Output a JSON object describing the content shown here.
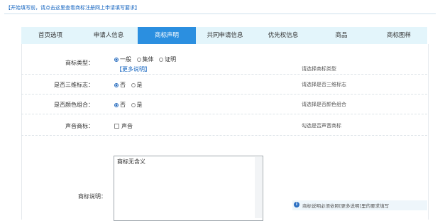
{
  "notice": "【开始填写前，请点击这里查看商标注册网上申请填写要求】",
  "tabs": [
    {
      "label": "首页选项",
      "active": false
    },
    {
      "label": "申请人信息",
      "active": false
    },
    {
      "label": "商标声明",
      "active": true
    },
    {
      "label": "共同申请信息",
      "active": false
    },
    {
      "label": "优先权信息",
      "active": false
    },
    {
      "label": "商品",
      "active": false
    },
    {
      "label": "商标图样",
      "active": false
    }
  ],
  "form": {
    "type": {
      "label": "商标类型：",
      "options": [
        "一般",
        "集体",
        "证明"
      ],
      "selected": "一般",
      "more_link": "【更多说明】",
      "hint": "请选择商标类型"
    },
    "three_d": {
      "label": "是否三维标志：",
      "options": [
        "否",
        "是"
      ],
      "selected": "否",
      "hint": "请选择是否三维标志"
    },
    "color": {
      "label": "是否颜色组合：",
      "options": [
        "否",
        "是"
      ],
      "selected": "否",
      "hint": "请选择是否颜色组合"
    },
    "sound": {
      "label": "声音商标：",
      "checkbox_label": "声音",
      "checked": false,
      "hint": "勾选是否声音商标"
    },
    "description": {
      "label": "商标说明：",
      "value": "商标无含义",
      "info": "商标说明必须依照[更多说明]里的要求填写"
    }
  },
  "colors": {
    "accent": "#2b8fe0",
    "tab_bg": "#e3f5fb",
    "link": "#1565c0"
  }
}
